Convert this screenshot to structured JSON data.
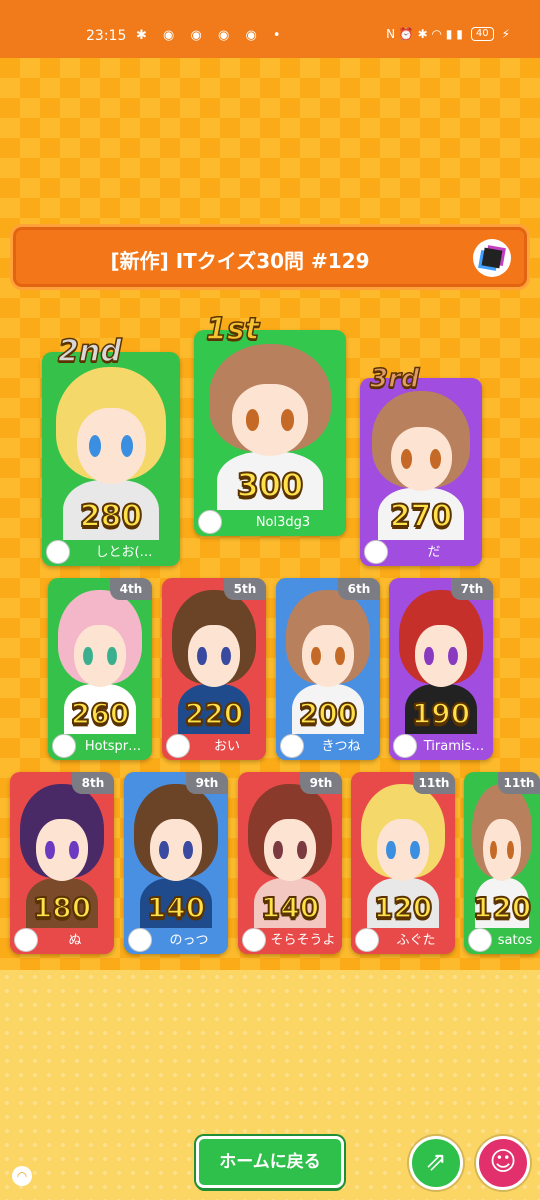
{
  "status_bar": {
    "time": "23:15",
    "notification_icons": [
      "pinwheel-icon",
      "discord-icon",
      "discord-icon",
      "discord-icon",
      "discord-icon",
      "dot-icon"
    ],
    "notification_glyphs": "✱ ◉ ◉ ◉ ◉ •",
    "system_glyphs": "N ⏰ ✱ ◠ ▮ ▮",
    "battery": "40"
  },
  "quiz": {
    "title": "[新作] ITクイズ30問 #129"
  },
  "podium": [
    {
      "rank": "2nd",
      "score": "280",
      "name": "しとお(…",
      "card_color": "#36c24a",
      "name_bar": "#36c24a",
      "hair": "#f5d86a",
      "eye": "#3a8fe0",
      "body": "#e8e8e8"
    },
    {
      "rank": "1st",
      "score": "300",
      "name": "Nol3dg3",
      "card_color": "#33c84d",
      "name_bar": "#33c84d",
      "hair": "#b9805e",
      "eye": "#c56a26",
      "body": "#f4f4f4"
    },
    {
      "rank": "3rd",
      "score": "270",
      "name": "だ",
      "card_color": "#a04de0",
      "name_bar": "#a04de0",
      "hair": "#b9805e",
      "eye": "#c56a26",
      "body": "#f4f4f4"
    }
  ],
  "row2": [
    {
      "rank": "4th",
      "score": "260",
      "name": "Hotspr…",
      "card_color": "#36c24a",
      "hair": "#f4b7c9",
      "eye": "#3bb08f",
      "body": "#ffffff"
    },
    {
      "rank": "5th",
      "score": "220",
      "name": "おい",
      "card_color": "#e84a4a",
      "hair": "#6b4326",
      "eye": "#3a4aa0",
      "body": "#1f4b8c"
    },
    {
      "rank": "6th",
      "score": "200",
      "name": "きつね",
      "card_color": "#4a90e2",
      "hair": "#b9805e",
      "eye": "#c56a26",
      "body": "#f4f4f4"
    },
    {
      "rank": "7th",
      "score": "190",
      "name": "Tiramis…",
      "card_color": "#a04de0",
      "hair": "#c6302a",
      "eye": "#8a3ac0",
      "body": "#222222"
    }
  ],
  "row3": [
    {
      "rank": "8th",
      "score": "180",
      "name": "ぬ",
      "card_color": "#e84a4a",
      "hair": "#4a2a66",
      "eye": "#6b3ac0",
      "body": "#7a4a2a"
    },
    {
      "rank": "9th",
      "score": "140",
      "name": "のっつ",
      "card_color": "#4a90e2",
      "hair": "#6b4326",
      "eye": "#3a4aa0",
      "body": "#1f4b8c"
    },
    {
      "rank": "9th",
      "score": "140",
      "name": "そらそうよ",
      "card_color": "#e84a4a",
      "hair": "#8a3a2a",
      "eye": "#7a3a40",
      "body": "#f3c8c0"
    },
    {
      "rank": "11th",
      "score": "120",
      "name": "ふぐた",
      "card_color": "#e84a4a",
      "hair": "#f5d86a",
      "eye": "#3a8fe0",
      "body": "#e8e8e8"
    },
    {
      "rank": "11th",
      "score": "120",
      "name": "satos",
      "card_color": "#36c24a",
      "hair": "#b9805e",
      "eye": "#c56a26",
      "body": "#f4f4f4"
    }
  ],
  "buttons": {
    "home": "ホームに戻る",
    "share_icon": "share-icon",
    "profile_icon": "smiley-icon"
  },
  "colors": {
    "status_bar": "#f17a1a",
    "background": "#fbab18",
    "title_bar": "#f37718",
    "score_text": "#ffe14a",
    "gold_badge": "#f5c430",
    "silver_badge": "#d8d8d8",
    "bronze_badge": "#e09a66"
  }
}
